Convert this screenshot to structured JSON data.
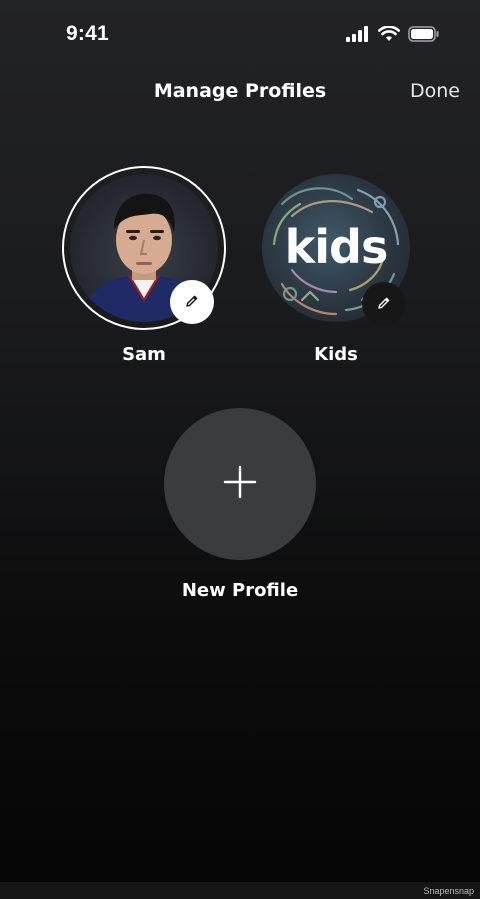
{
  "status_bar": {
    "time": "9:41",
    "icons": [
      "cellular-signal-icon",
      "wifi-icon",
      "battery-icon"
    ]
  },
  "header": {
    "title": "Manage Profiles",
    "done_label": "Done"
  },
  "profiles": [
    {
      "name": "Sam",
      "avatar": "photo-portrait",
      "selected": true,
      "edit_icon": "pencil-icon"
    },
    {
      "name": "Kids",
      "avatar": "kids-logo",
      "avatar_text": "kids",
      "selected": false,
      "edit_icon": "pencil-icon"
    }
  ],
  "new_profile": {
    "label": "New Profile",
    "icon": "plus-icon"
  },
  "watermark": "Snapensnap",
  "colors": {
    "background_top": "#222326",
    "background_bottom": "#050505",
    "new_profile_circle": "#3b3c3e",
    "text": "#ffffff"
  }
}
